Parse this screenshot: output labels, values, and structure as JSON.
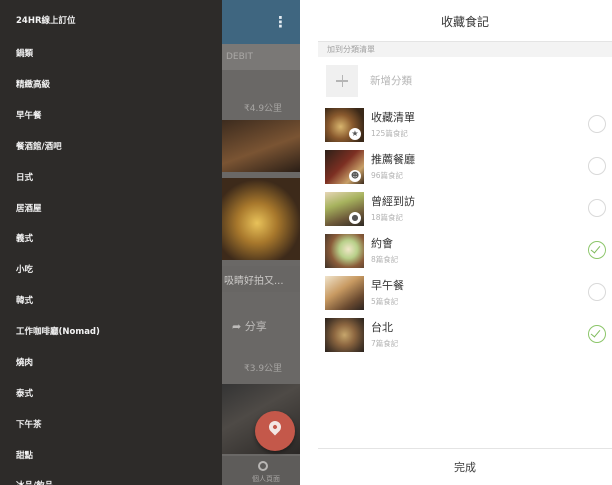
{
  "left": {
    "drawer_items": [
      "24HR線上訂位",
      "鍋類",
      "精緻高級",
      "早午餐",
      "餐酒館/酒吧",
      "日式",
      "居酒屋",
      "義式",
      "小吃",
      "韓式",
      "工作咖啡廳(Nomad)",
      "燒肉",
      "泰式",
      "下午茶",
      "甜點",
      "冰品/飲品"
    ],
    "background_app": {
      "tab_text": "DEBIT",
      "price_1": "₹4.9公里",
      "card_title": "吸睛好拍又...",
      "share_label": "分享",
      "price_2": "₹3.9公里",
      "bottom_nav_label": "個人頁面"
    }
  },
  "right": {
    "title": "收藏食記",
    "section_header": "加到分類清單",
    "add_category": "新增分類",
    "collections": [
      {
        "name": "收藏清單",
        "count": "125篇食記",
        "checked": false,
        "badge": "★"
      },
      {
        "name": "推薦餐廳",
        "count": "96篇食記",
        "checked": false,
        "badge": "☻"
      },
      {
        "name": "曾經到訪",
        "count": "18篇食記",
        "checked": false,
        "badge": "●"
      },
      {
        "name": "約會",
        "count": "8篇食記",
        "checked": true,
        "badge": ""
      },
      {
        "name": "早午餐",
        "count": "5篇食記",
        "checked": false,
        "badge": ""
      },
      {
        "name": "台北",
        "count": "7篇食記",
        "checked": true,
        "badge": ""
      }
    ],
    "done_label": "完成",
    "accent_color": "#7fbb5c"
  }
}
